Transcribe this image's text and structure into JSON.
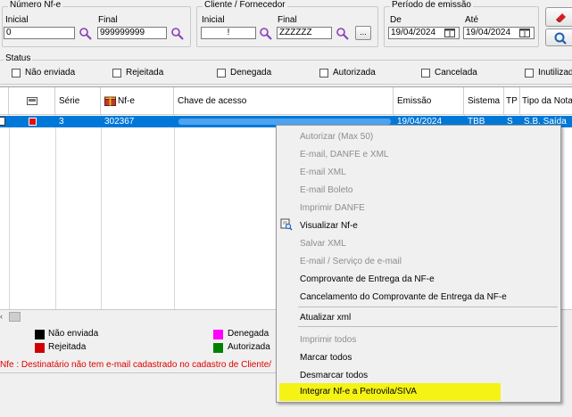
{
  "filters": {
    "numero_nfe": {
      "legend": "Número Nf-e",
      "inicial_label": "Inicial",
      "inicial_value": "0",
      "final_label": "Final",
      "final_value": "999999999"
    },
    "cliente": {
      "legend": "Cliente / Fornecedor",
      "inicial_label": "Inicial",
      "inicial_value": "!",
      "final_label": "Final",
      "final_value": "ZZZZZZ",
      "ellipsis_label": "..."
    },
    "periodo": {
      "legend": "Período de emissão",
      "de_label": "De",
      "de_value": "19/04/2024",
      "ate_label": "Até",
      "ate_value": "19/04/2024"
    }
  },
  "status": {
    "label": "Status",
    "options": [
      "Não enviada",
      "Rejeitada",
      "Denegada",
      "Autorizada",
      "Cancelada",
      "Inutilizad"
    ]
  },
  "grid": {
    "headers": [
      "Série",
      "Nf-e",
      "Chave de acesso",
      "Emissão",
      "Sistema",
      "TP",
      "Tipo da Nota"
    ],
    "row": {
      "serie": "3",
      "nfe": "302367",
      "emissao": "19/04/2024",
      "sistema": "TBB",
      "tp": "S",
      "tipo": "S.B. Saída"
    }
  },
  "legend": {
    "items": [
      {
        "label": "Não enviada",
        "color": "#000000"
      },
      {
        "label": "Rejeitada",
        "color": "#d00000"
      },
      {
        "label": "Denegada",
        "color": "#ff00ff"
      },
      {
        "label": "Autorizada",
        "color": "#008000"
      }
    ]
  },
  "error_text": "Nfe   : Destinatário não tem e-mail cadastrado no cadastro de Cliente/",
  "context_menu": {
    "items": [
      {
        "label": "Autorizar (Max 50)",
        "enabled": false
      },
      {
        "label": "E-mail, DANFE e XML",
        "enabled": false
      },
      {
        "label": "E-mail XML",
        "enabled": false
      },
      {
        "label": "E-mail Boleto",
        "enabled": false
      },
      {
        "label": "Imprimir DANFE",
        "enabled": false
      },
      {
        "label": "Visualizar Nf-e",
        "enabled": true
      },
      {
        "label": "Salvar XML",
        "enabled": false
      },
      {
        "label": "E-mail / Serviço de e-mail",
        "enabled": false
      },
      {
        "label": "Comprovante de Entrega da NF-e",
        "enabled": true
      },
      {
        "label": "Cancelamento do Comprovante de Entrega da NF-e",
        "enabled": true
      },
      {
        "label": "Atualizar xml",
        "enabled": true
      },
      {
        "label": "Imprimir todos",
        "enabled": false
      },
      {
        "label": "Marcar todos",
        "enabled": true
      },
      {
        "label": "Desmarcar todos",
        "enabled": true
      },
      {
        "label": "Integrar Nf-e a Petrovila/SIVA",
        "enabled": true,
        "highlighted": true
      }
    ]
  },
  "colors": {
    "selection": "#0078d7",
    "highlight": "#f5f316",
    "error": "#e00000"
  }
}
